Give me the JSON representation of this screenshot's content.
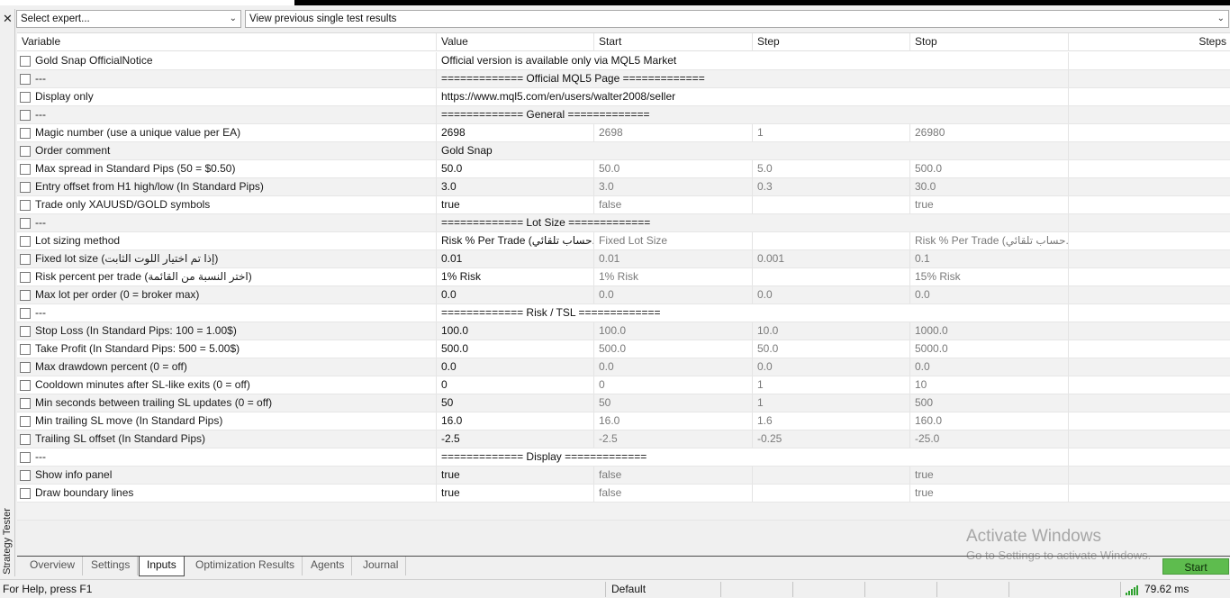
{
  "window": {
    "panel_title": "Strategy Tester",
    "close_glyph": "✕"
  },
  "toolbar": {
    "expert_select": "Select expert...",
    "results_select": "View previous single test results"
  },
  "columns": {
    "variable": "Variable",
    "value": "Value",
    "start": "Start",
    "step": "Step",
    "stop": "Stop",
    "steps": "Steps"
  },
  "rows": [
    {
      "var": "Gold Snap OfficialNotice",
      "sep": "Official version is available only via MQL5 Market"
    },
    {
      "var": "---",
      "sep": "============= Official MQL5 Page ============="
    },
    {
      "var": "Display only",
      "sep": "https://www.mql5.com/en/users/walter2008/seller"
    },
    {
      "var": "---",
      "sep": "============= General ============="
    },
    {
      "var": "Magic number (use a unique value per EA)",
      "value": "2698",
      "start": "2698",
      "step": "1",
      "stop": "26980"
    },
    {
      "var": "Order comment",
      "sep": "Gold Snap"
    },
    {
      "var": "Max spread in Standard Pips (50 = $0.50)",
      "value": "50.0",
      "start": "50.0",
      "step": "5.0",
      "stop": "500.0"
    },
    {
      "var": "Entry offset from H1 high/low (In Standard Pips)",
      "value": "3.0",
      "start": "3.0",
      "step": "0.3",
      "stop": "30.0"
    },
    {
      "var": "Trade only XAUUSD/GOLD symbols",
      "value": "true",
      "start": "false",
      "step": "",
      "stop": "true"
    },
    {
      "var": "---",
      "sep": "============= Lot Size ============="
    },
    {
      "var": "Lot sizing method",
      "value": "Risk % Per Trade (حساب تلقائي...",
      "start": "Fixed Lot Size",
      "step": "",
      "stop": "Risk % Per Trade (حساب تلقائي..."
    },
    {
      "var": "Fixed lot size (إذا تم اختيار اللوت الثابت)",
      "value": "0.01",
      "start": "0.01",
      "step": "0.001",
      "stop": "0.1"
    },
    {
      "var": "Risk percent per trade (اختر النسبة من القائمة)",
      "value": "1% Risk",
      "start": "1% Risk",
      "step": "",
      "stop": "15% Risk"
    },
    {
      "var": "Max lot per order (0 = broker max)",
      "value": "0.0",
      "start": "0.0",
      "step": "0.0",
      "stop": "0.0"
    },
    {
      "var": "---",
      "sep": "============= Risk / TSL ============="
    },
    {
      "var": "Stop Loss (In Standard Pips: 100 = 1.00$)",
      "value": "100.0",
      "start": "100.0",
      "step": "10.0",
      "stop": "1000.0"
    },
    {
      "var": "Take Profit (In Standard Pips: 500 = 5.00$)",
      "value": "500.0",
      "start": "500.0",
      "step": "50.0",
      "stop": "5000.0"
    },
    {
      "var": "Max drawdown percent (0 = off)",
      "value": "0.0",
      "start": "0.0",
      "step": "0.0",
      "stop": "0.0"
    },
    {
      "var": "Cooldown minutes after SL-like exits (0 = off)",
      "value": "0",
      "start": "0",
      "step": "1",
      "stop": "10"
    },
    {
      "var": "Min seconds between trailing SL updates (0 = off)",
      "value": "50",
      "start": "50",
      "step": "1",
      "stop": "500"
    },
    {
      "var": "Min trailing SL move (In Standard Pips)",
      "value": "16.0",
      "start": "16.0",
      "step": "1.6",
      "stop": "160.0"
    },
    {
      "var": "Trailing SL offset (In Standard Pips)",
      "value": "-2.5",
      "start": "-2.5",
      "step": "-0.25",
      "stop": "-25.0"
    },
    {
      "var": "---",
      "sep": "============= Display ============="
    },
    {
      "var": "Show info panel",
      "value": "true",
      "start": "false",
      "step": "",
      "stop": "true"
    },
    {
      "var": "Draw boundary lines",
      "value": "true",
      "start": "false",
      "step": "",
      "stop": "true"
    }
  ],
  "watermark": {
    "line1": "Activate Windows",
    "line2": "Go to Settings to activate Windows."
  },
  "tabs": [
    "Overview",
    "Settings",
    "Inputs",
    "Optimization Results",
    "Agents",
    "Journal"
  ],
  "active_tab": "Inputs",
  "start_button": "Start",
  "status": {
    "help": "For Help, press F1",
    "profile": "Default",
    "ping": "79.62 ms"
  },
  "colors": {
    "start_button": "#5ebc4e",
    "signal": "#2fa12f",
    "row_alt": "#f2f2f2"
  }
}
